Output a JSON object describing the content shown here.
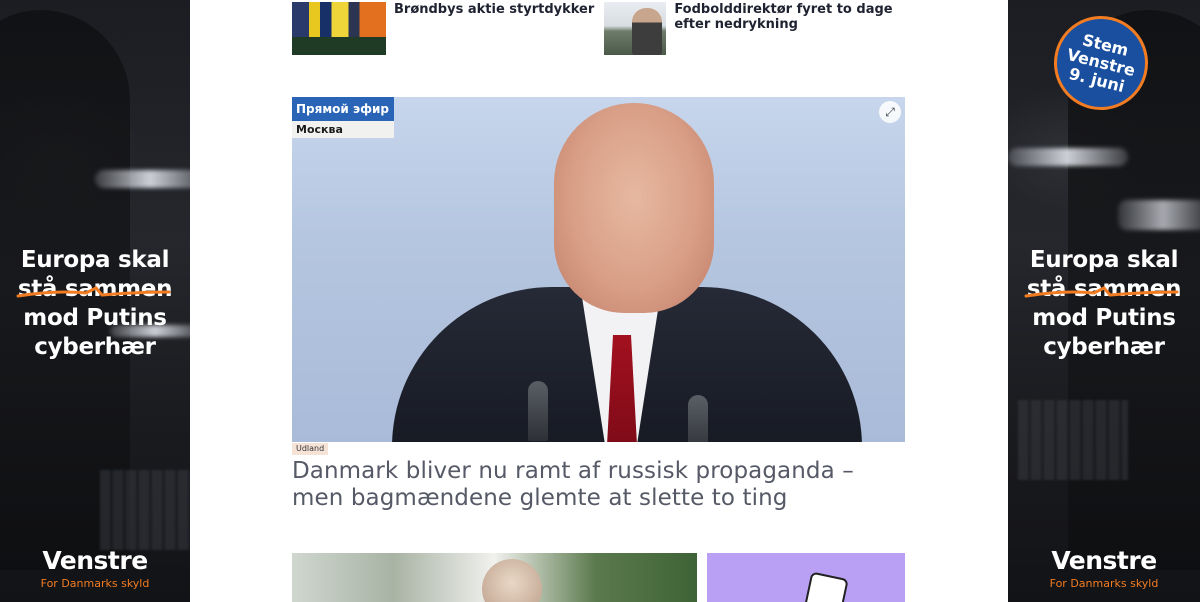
{
  "ads": {
    "left": {
      "slogan": [
        "Europa skal",
        "stå sammen",
        "mod Putins",
        "cyberhær"
      ],
      "brand": "Venstre",
      "tagline": "For Danmarks skyld"
    },
    "right": {
      "badge": [
        "Stem",
        "Venstre",
        "9. juni"
      ],
      "slogan": [
        "Europa skal",
        "stå sammen",
        "mod Putins",
        "cyberhær"
      ],
      "brand": "Venstre",
      "tagline": "For Danmarks skyld"
    },
    "accent_color": "#f27c22"
  },
  "top_articles": [
    {
      "title": "Brøndbys aktie styrtdykker"
    },
    {
      "title": "Fodbolddirektør fyret to dage efter nedrykning"
    }
  ],
  "hero": {
    "tv_label": "Прямой эфир",
    "tv_location": "Москва",
    "category": "Udland",
    "headline": "Danmark bliver nu ramt af russisk propaganda – men bagmændene glemte at slette to ting",
    "expand_icon": "expand-icon"
  }
}
